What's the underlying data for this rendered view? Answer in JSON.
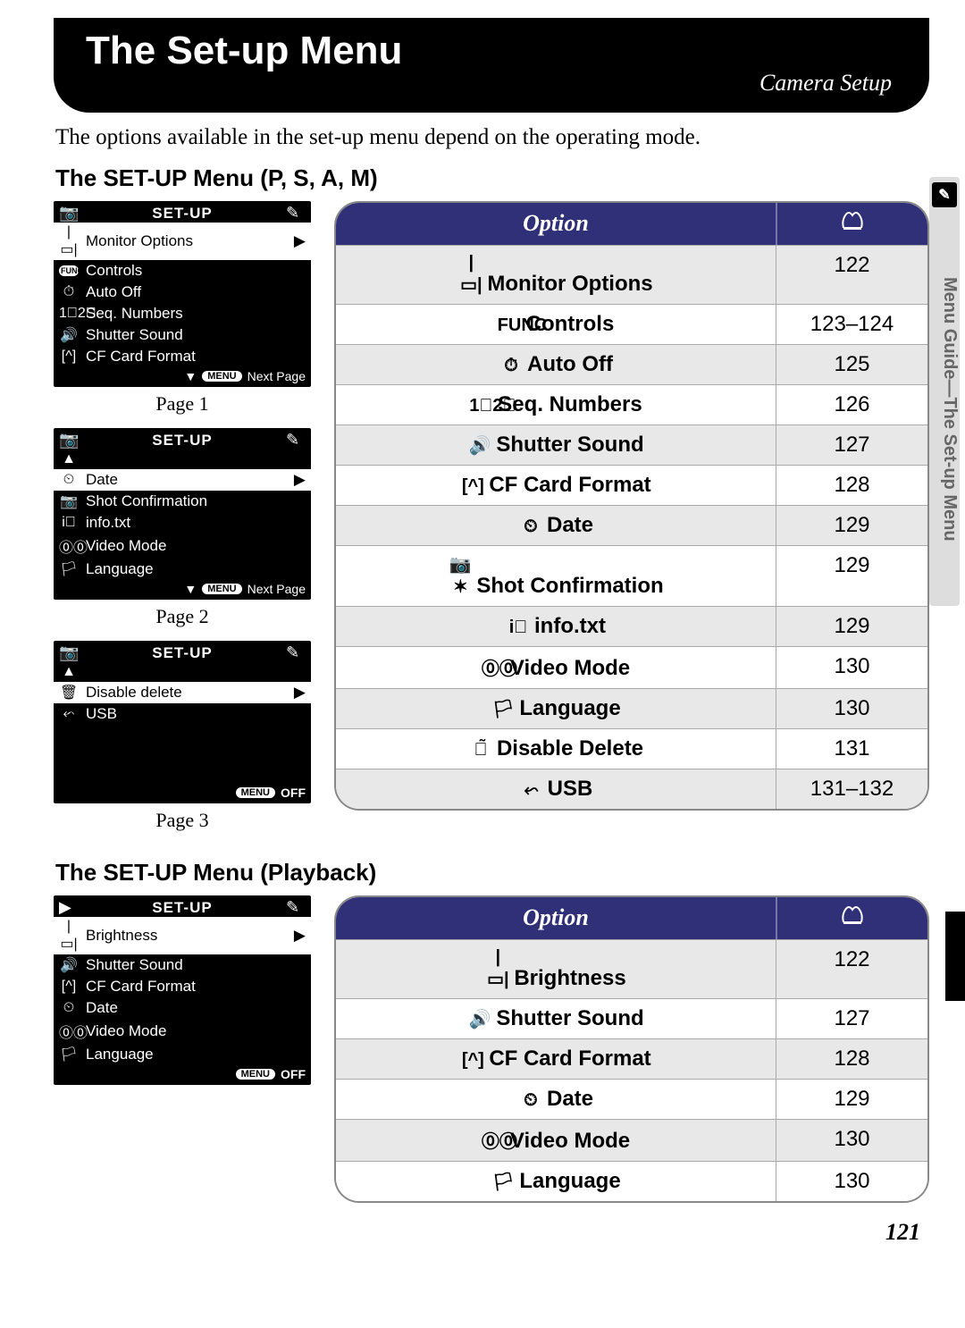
{
  "banner": {
    "title": "The Set-up Menu",
    "subtitle": "Camera Setup"
  },
  "intro": "The options available in the set-up menu depend on the operating mode.",
  "section1_title": "The SET-UP Menu (P, S, A, M)",
  "section2_title": "The SET-UP Menu (Playback)",
  "lcd_title": "SET-UP",
  "lcd_next": "Next Page",
  "lcd_off": "OFF",
  "lcd_menu": "MENU",
  "page1_label": "Page 1",
  "page2_label": "Page 2",
  "page3_label": "Page 3",
  "lcd1": [
    "Monitor Options",
    "Controls",
    "Auto Off",
    "Seq. Numbers",
    "Shutter Sound",
    "CF Card Format"
  ],
  "lcd2": [
    "Date",
    "Shot Confirmation",
    "info.txt",
    "Video Mode",
    "Language"
  ],
  "lcd3": [
    "Disable delete",
    "USB"
  ],
  "lcd4": [
    "Brightness",
    "Shutter Sound",
    "CF Card Format",
    "Date",
    "Video Mode",
    "Language"
  ],
  "table_header": {
    "option": "Option",
    "page_icon": "⩃"
  },
  "table1": [
    {
      "icon": "|▭|",
      "label": "Monitor Options",
      "page": "122"
    },
    {
      "icon": "FUNC",
      "label": "Controls",
      "page": "123–124"
    },
    {
      "icon": "⏱",
      "label": "Auto Off",
      "page": "125"
    },
    {
      "icon": "1⃣2⃣",
      "label": "Seq. Numbers",
      "page": "126"
    },
    {
      "icon": "🔊",
      "label": "Shutter Sound",
      "page": "127"
    },
    {
      "icon": "[^]",
      "label": "CF Card Format",
      "page": "128"
    },
    {
      "icon": "⏲",
      "label": "Date",
      "page": "129"
    },
    {
      "icon": "📷✶",
      "label": "Shot Confirmation",
      "page": "129"
    },
    {
      "icon": "i⃣",
      "label": "info.txt",
      "page": "129"
    },
    {
      "icon": "⓪⓪",
      "label": "Video Mode",
      "page": "130"
    },
    {
      "icon": "🏳",
      "label": "Language",
      "page": "130"
    },
    {
      "icon": "🗑̃",
      "label": "Disable Delete",
      "page": "131"
    },
    {
      "icon": "⬿",
      "label": "USB",
      "page": "131–132"
    }
  ],
  "table2": [
    {
      "icon": "|▭|",
      "label": "Brightness",
      "page": "122"
    },
    {
      "icon": "🔊",
      "label": "Shutter Sound",
      "page": "127"
    },
    {
      "icon": "[^]",
      "label": "CF Card Format",
      "page": "128"
    },
    {
      "icon": "⏲",
      "label": "Date",
      "page": "129"
    },
    {
      "icon": "⓪⓪",
      "label": "Video Mode",
      "page": "130"
    },
    {
      "icon": "🏳",
      "label": "Language",
      "page": "130"
    }
  ],
  "side_tab": "Menu Guide—The Set-up Menu",
  "page_number": "121"
}
